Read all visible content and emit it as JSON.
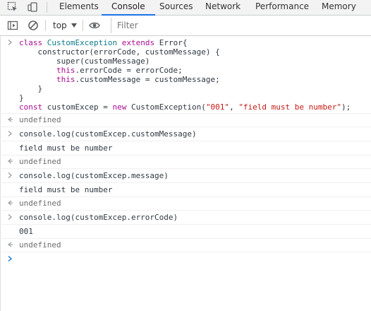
{
  "devtools": {
    "tabs": [
      {
        "label": "Elements"
      },
      {
        "label": "Console"
      },
      {
        "label": "Sources"
      },
      {
        "label": "Network"
      },
      {
        "label": "Performance"
      },
      {
        "label": "Memory"
      }
    ],
    "active_tab": "Console",
    "colors": {
      "accent": "#1a73e8",
      "keyword": "#aa0d91",
      "string": "#c41a16",
      "class": "#1c00cf"
    }
  },
  "toolbar": {
    "context": "top",
    "filter_placeholder": "Filter"
  },
  "console": {
    "entries": [
      {
        "type": "input",
        "lines": [
          "class CustomException extends Error{",
          "    constructor(errorCode, customMessage) {",
          "        super(customMessage)",
          "        this.errorCode = errorCode;",
          "        this.customMessage = customMessage;",
          "    }",
          "}",
          "const customExcep = new CustomException(\"001\", \"field must be number\");"
        ]
      },
      {
        "type": "result",
        "text": "undefined"
      },
      {
        "type": "input",
        "text": "console.log(customExcep.customMessage)"
      },
      {
        "type": "log",
        "text": "field must be number"
      },
      {
        "type": "result",
        "text": "undefined"
      },
      {
        "type": "input",
        "text": "console.log(customExcep.message)"
      },
      {
        "type": "log",
        "text": "field must be number"
      },
      {
        "type": "result",
        "text": "undefined"
      },
      {
        "type": "input",
        "text": "console.log(customExcep.errorCode)"
      },
      {
        "type": "log",
        "text": "001"
      },
      {
        "type": "result",
        "text": "undefined"
      }
    ]
  }
}
